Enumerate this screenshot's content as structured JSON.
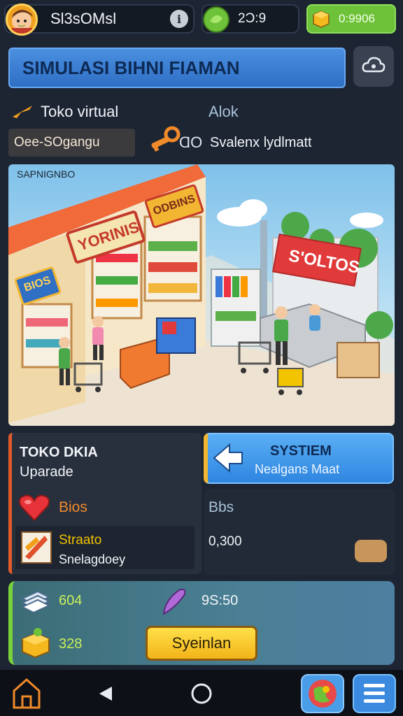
{
  "player": {
    "name": "Sl3sOMsl"
  },
  "currency": {
    "gems": "2Ɔ:9",
    "gold": "0:9906"
  },
  "title": "SIMULASI BIHNI FIAMAN",
  "shop": {
    "label": "Toko virtual",
    "name_value": "Oee-SOgangu",
    "right_label": "Alok",
    "right_value": "Svalenx lydlmatt",
    "key_count": "ⱭO"
  },
  "scene": {
    "corner_label": "SAPNIGNBO",
    "sign_left": "YORINIS",
    "sign_top": "ODBINS",
    "sign_side": "BIOS",
    "sign_right": "S'OLTOS"
  },
  "upgrade_panel": {
    "title": "TOKO DKIA",
    "subtitle": "Uparade",
    "heart_label": "Bios",
    "item_title": "Straato",
    "item_subtitle": "Snelagdoey"
  },
  "system_button": {
    "title": "SYSTIEM",
    "subtitle": "Nealgans Maat"
  },
  "side_info": {
    "label": "Bbs",
    "value": "0,300"
  },
  "stats": {
    "stat1": "604",
    "stat2": "328",
    "stat3": "9S:50"
  },
  "action_button": "Syeinlan",
  "colors": {
    "accent_blue": "#2f86e0",
    "accent_green": "#6ec23a",
    "accent_yellow": "#f2b418"
  },
  "icons": [
    "avatar",
    "info-icon",
    "leaf-gem-icon",
    "gold-cube-icon",
    "cloud-settings-icon",
    "plane-icon",
    "key-icon",
    "heart-icon",
    "item-card-icon",
    "back-arrow-icon",
    "cash-stack-icon",
    "feather-icon",
    "gold-box-icon",
    "home-icon",
    "back-triangle-icon",
    "home-circle-icon",
    "map-icon",
    "menu-icon"
  ]
}
